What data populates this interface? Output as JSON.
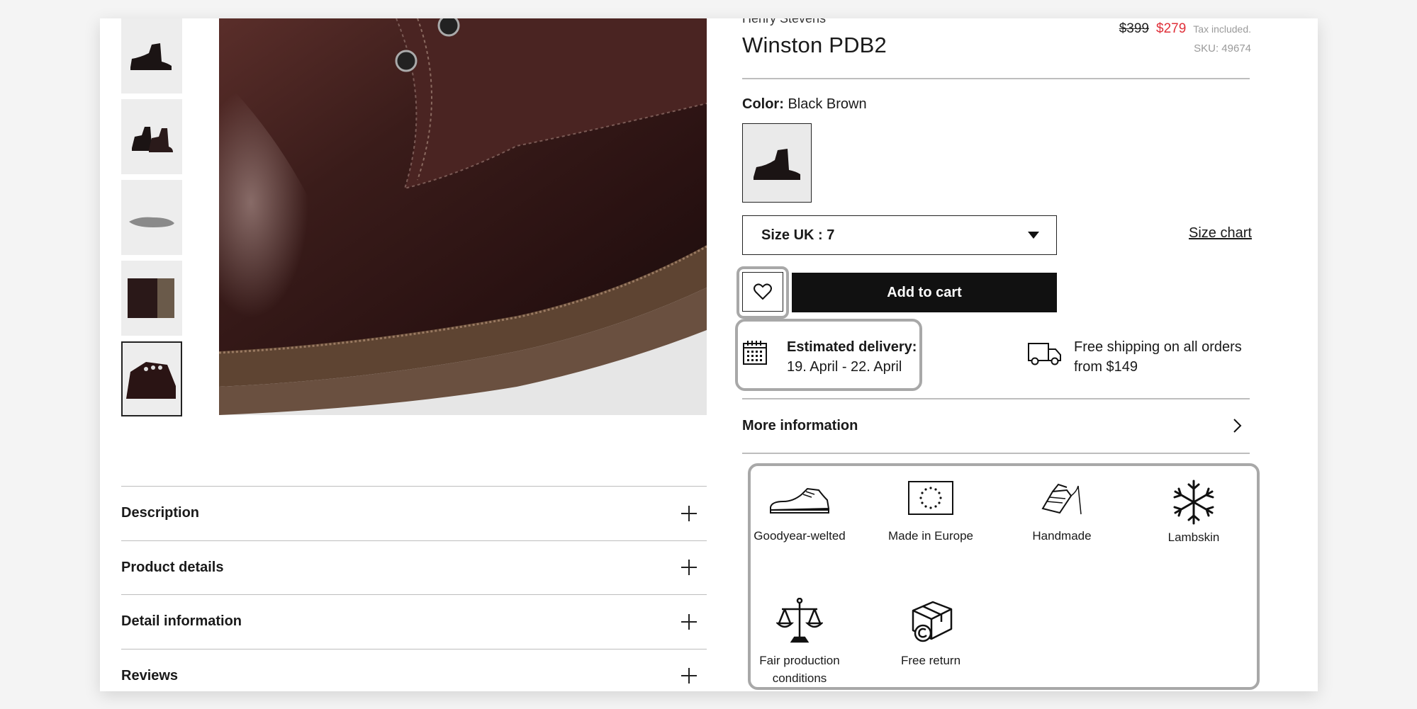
{
  "product": {
    "brand": "Henry Stevens",
    "title": "Winston PDB2",
    "old_price": "$399",
    "new_price": "$279",
    "tax_note": "Tax included.",
    "sku": "SKU: 49674"
  },
  "color": {
    "label": "Color:",
    "value": "Black Brown"
  },
  "size": {
    "selected": "Size UK : 7",
    "chart_link": "Size chart"
  },
  "actions": {
    "add_to_cart": "Add to cart"
  },
  "delivery": {
    "label": "Estimated delivery:",
    "dates": "19. April - 22. April"
  },
  "shipping": {
    "text": "Free shipping on all orders from $149"
  },
  "more_info": "More information",
  "accordion": [
    "Description",
    "Product details",
    "Detail information",
    "Reviews"
  ],
  "features": [
    "Goodyear-welted",
    "Made in Europe",
    "Handmade",
    "Lambskin",
    "Fair production conditions",
    "Free return"
  ],
  "colors": {
    "sale_price": "#e0303a",
    "button_bg": "#111111",
    "highlight": "#a8a8a8"
  }
}
